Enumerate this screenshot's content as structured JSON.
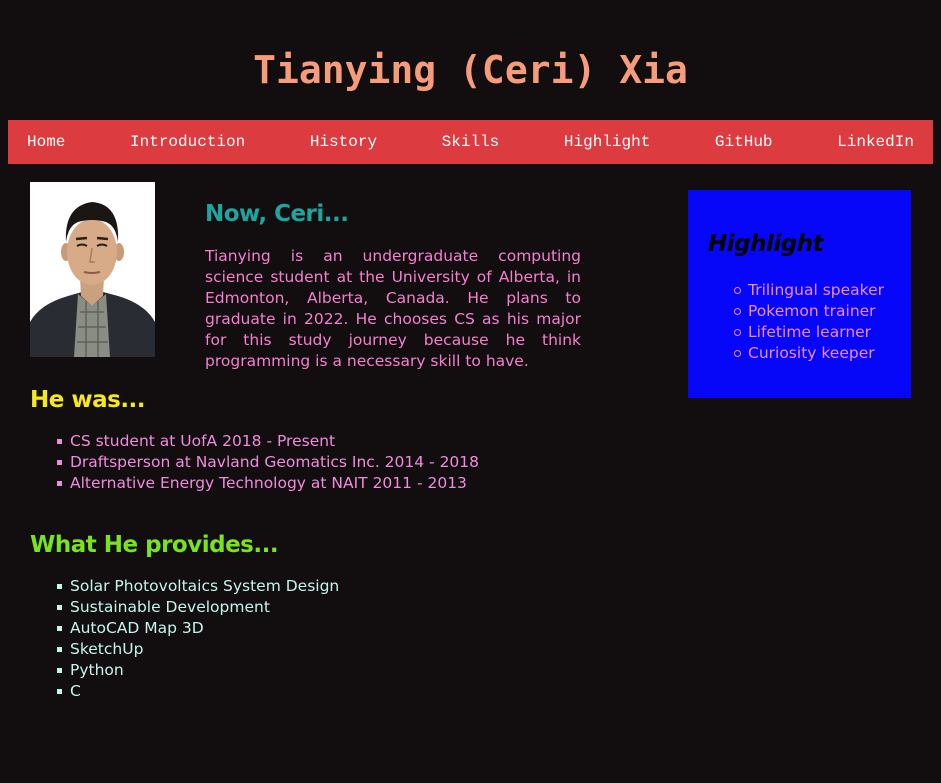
{
  "header": {
    "title": "Tianying (Ceri) Xia"
  },
  "nav": {
    "items": [
      "Home",
      "Introduction",
      "History",
      "Skills",
      "Highlight",
      "GitHub",
      "LinkedIn"
    ]
  },
  "intro": {
    "heading": "Now, Ceri...",
    "text": "Tianying is an undergraduate computing science student at the University of Alberta, in Edmonton, Alberta, Canada. He plans to graduate in 2022. He chooses CS as his major for this study journey because he think programming is a necessary skill to have."
  },
  "highlight": {
    "title": "Highlight",
    "items": [
      "Trilingual speaker",
      "Pokemon trainer",
      "Lifetime learner",
      "Curiosity keeper"
    ]
  },
  "history": {
    "heading": "He was...",
    "items": [
      "CS student at UofA 2018 - Present",
      "Draftsperson at Navland Geomatics Inc. 2014 - 2018",
      "Alternative Energy Technology at NAIT 2011 - 2013"
    ]
  },
  "skills": {
    "heading": "What He provides...",
    "items": [
      "Solar Photovoltaics System Design",
      "Sustainable Development",
      "AutoCAD Map 3D",
      "SketchUp",
      "Python",
      "C"
    ]
  },
  "colors": {
    "background": "#120d0e",
    "title": "#f59c7a",
    "nav_bg": "#dc3b3f",
    "intro_heading": "#1da69f",
    "intro_text": "#f57fd0",
    "highlight_bg": "#0606f8",
    "was_heading": "#f5e81b",
    "provides_heading": "#7be21e",
    "provides_text": "#c3f6ee"
  }
}
